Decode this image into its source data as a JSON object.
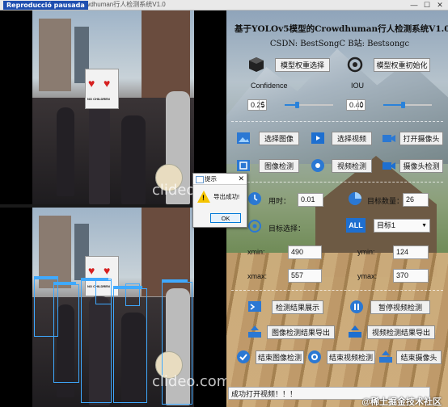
{
  "window": {
    "title": "基于YOLOv5模型的Crowdhuman行人检测系统V1.0",
    "watermark": "Reproducció pausada",
    "controls": [
      "—",
      "☐",
      "✕"
    ]
  },
  "app": {
    "title": "基于YOLOv5模型的Crowdhuman行人检测系统V1.0",
    "subtitle": "CSDN:  BestSongC  B站: Bestsongc"
  },
  "model": {
    "select_label": "模型权重选择",
    "init_label": "模型权重初始化",
    "confidence_label": "Confidence",
    "iou_label": "IOU",
    "confidence_value": "0.25",
    "iou_value": "0.40",
    "confidence_level": 0.25,
    "iou_level": 0.4
  },
  "actions": {
    "select_image": "选择图像",
    "select_video": "选择视频",
    "open_camera": "打开摄像头",
    "image_detect": "图像检测",
    "video_detect": "视频检测",
    "camera_detect": "摄像头检测"
  },
  "stats": {
    "time_label": "用时：",
    "time_value": "0.01",
    "count_label": "目标数量：",
    "count_value": "26",
    "select_label": "目标选择：",
    "select_value": "目标1",
    "xmin_label": "xmin:",
    "xmin_value": "490",
    "ymin_label": "ymin:",
    "ymin_value": "124",
    "xmax_label": "xmax:",
    "xmax_value": "557",
    "ymax_label": "ymax:",
    "ymax_value": "370"
  },
  "results": {
    "show_result": "检测结果展示",
    "pause_video": "暂停视频检测",
    "export_image": "图像检测结果导出",
    "export_video": "视频检测结果导出",
    "end_image": "结束图像检测",
    "end_video": "结束视频检测",
    "end_camera": "结束摄像头"
  },
  "status": {
    "message": "成功打开视频！！！"
  },
  "dialog": {
    "title": "提示",
    "message": "导出成功!",
    "ok": "OK",
    "close": "✕"
  },
  "video": {
    "sign_text": "NO CHILDREN",
    "clip_brand": "clideo.com"
  },
  "footer_watermark": "@稀土掘金技术社区",
  "colors": {
    "accent": "#2a82da",
    "bbox": "#3fa9ff",
    "warning": "#f5c400"
  }
}
